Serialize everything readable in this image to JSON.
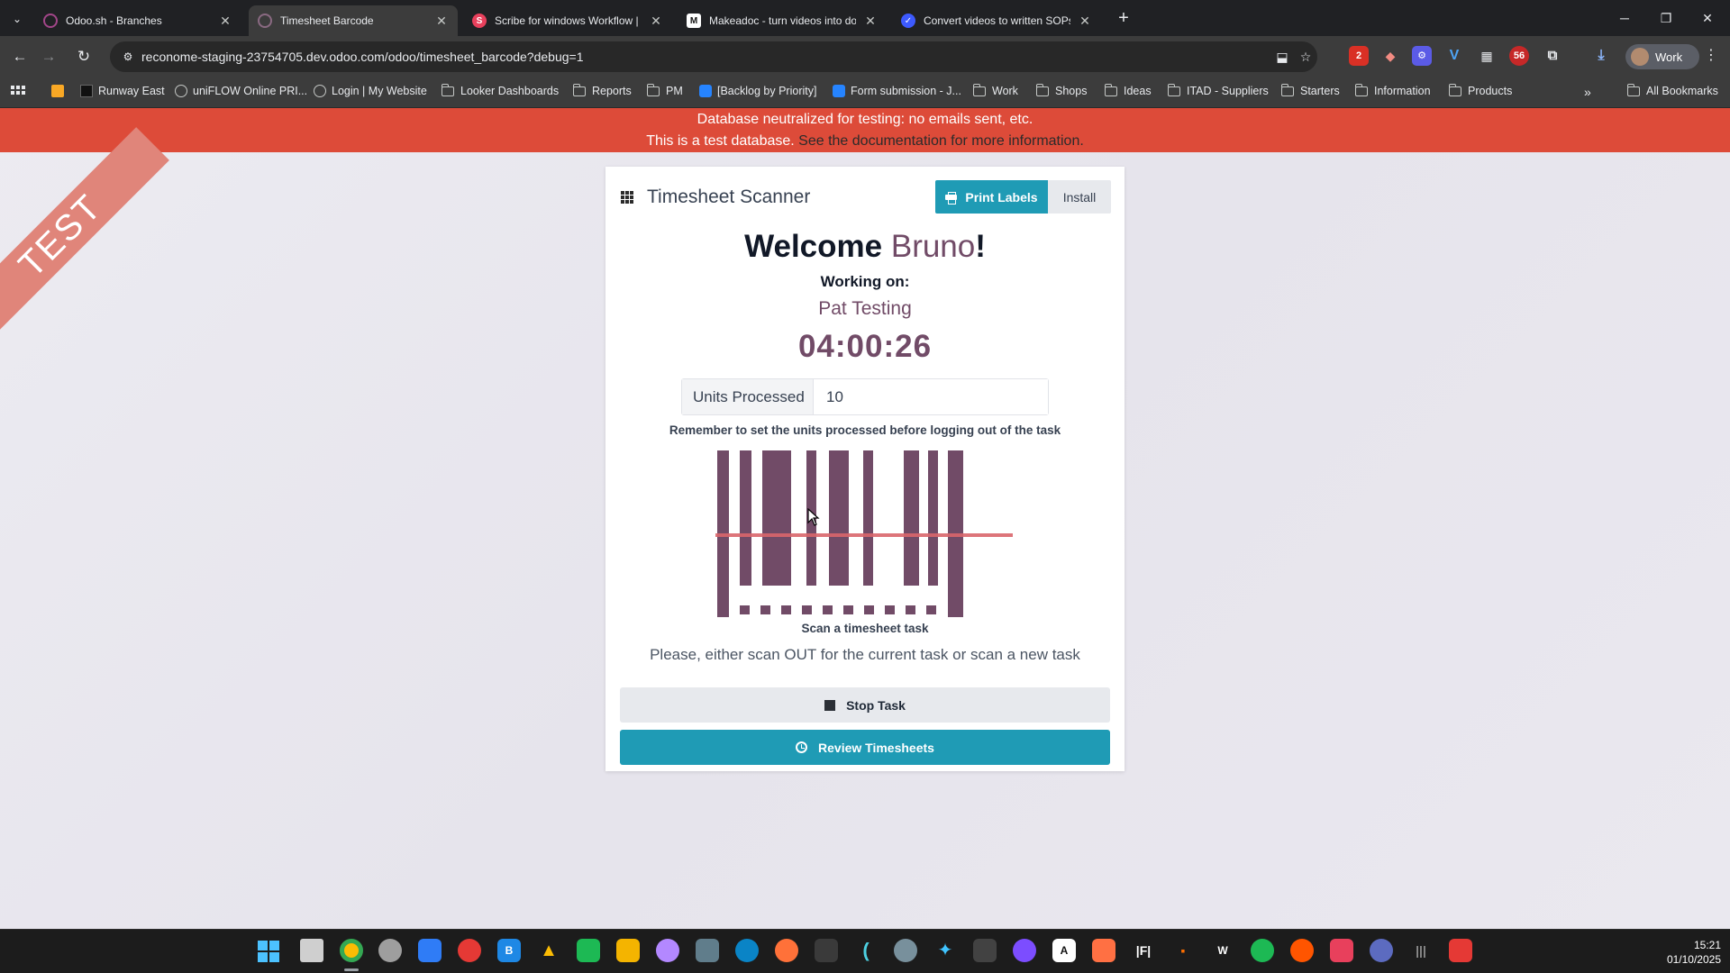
{
  "browser": {
    "tabs": [
      {
        "title": "Odoo.sh - Branches",
        "favicon": "odoo-icon",
        "color": "#a24689"
      },
      {
        "title": "Timesheet Barcode",
        "favicon": "odoo-icon",
        "color": "#714b67",
        "active": true
      },
      {
        "title": "Scribe for windows Workflow | S",
        "favicon": "scribe-icon",
        "color": "#e8405c"
      },
      {
        "title": "Makeadoc - turn videos into do",
        "favicon": "makeadoc-icon",
        "color": "#ffffff"
      },
      {
        "title": "Convert videos to written SOPs",
        "favicon": "check-circle-icon",
        "color": "#3d5afe"
      }
    ],
    "url": "reconome-staging-23754705.dev.odoo.com/odoo/timesheet_barcode?debug=1",
    "profile_label": "Work",
    "extension_badges": [
      "2",
      "56"
    ],
    "bookmarks": [
      {
        "label": "Runway East",
        "icon": "square-icon"
      },
      {
        "label": "uniFLOW Online PRI...",
        "icon": "uniflow-icon"
      },
      {
        "label": "Login | My Website",
        "icon": "globe-icon"
      },
      {
        "label": "Looker Dashboards",
        "icon": "folder-icon"
      },
      {
        "label": "Reports",
        "icon": "folder-icon"
      },
      {
        "label": "PM",
        "icon": "folder-icon"
      },
      {
        "label": "[Backlog by Priority]",
        "icon": "jira-icon"
      },
      {
        "label": "Form submission - J...",
        "icon": "jira-icon"
      },
      {
        "label": "Work",
        "icon": "folder-icon"
      },
      {
        "label": "Shops",
        "icon": "folder-icon"
      },
      {
        "label": "Ideas",
        "icon": "folder-icon"
      },
      {
        "label": "ITAD - Suppliers",
        "icon": "folder-icon"
      },
      {
        "label": "Starters",
        "icon": "folder-icon"
      },
      {
        "label": "Information",
        "icon": "folder-icon"
      },
      {
        "label": "Products",
        "icon": "folder-icon"
      }
    ],
    "all_bookmarks": "All Bookmarks"
  },
  "banner": {
    "line1": "Database neutralized for testing: no emails sent, etc.",
    "line2": "This is a test database.",
    "link": "See the documentation for more information."
  },
  "ribbon": "TEST",
  "app": {
    "title": "Timesheet Scanner",
    "print_labels": "Print Labels",
    "install": "Install",
    "welcome_prefix": "Welcome",
    "user_name": "Bruno",
    "welcome_suffix": "!",
    "working_on": "Working on:",
    "task_name": "Pat Testing",
    "timer": "04:00:26",
    "units_label": "Units Processed",
    "units_value": "10",
    "remember": "Remember to set the units processed before logging out of the task",
    "scan_caption": "Scan a timesheet task",
    "instruction": "Please, either scan OUT for the current task or scan a new task",
    "stop_task": "Stop Task",
    "review_timesheets": "Review Timesheets"
  },
  "colors": {
    "odoo_purple": "#714b67",
    "odoo_teal": "#1f9bb5",
    "test_red": "#dd4b39",
    "scan_line": "#d9666b"
  },
  "system_tray": {
    "time": "15:21",
    "date": "01/10/2025"
  }
}
